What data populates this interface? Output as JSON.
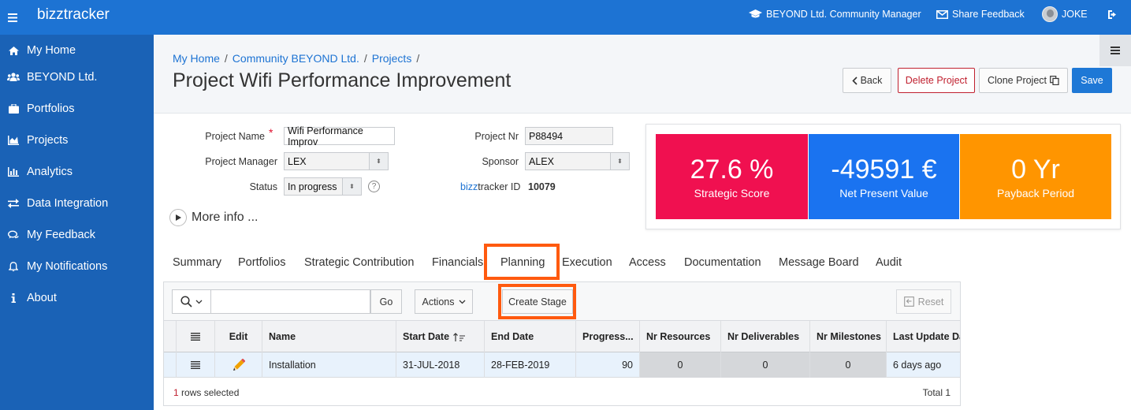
{
  "app": {
    "brand": "bizztracker",
    "role": "BEYOND Ltd. Community Manager",
    "feedback": "Share Feedback",
    "user": "JOKE"
  },
  "sidebar": {
    "items": [
      {
        "label": "My Home",
        "icon": "home-icon"
      },
      {
        "label": "BEYOND Ltd.",
        "icon": "users-icon"
      },
      {
        "label": "Portfolios",
        "icon": "briefcase-icon"
      },
      {
        "label": "Projects",
        "icon": "area-chart-icon"
      },
      {
        "label": "Analytics",
        "icon": "bar-chart-icon"
      },
      {
        "label": "Data Integration",
        "icon": "exchange-icon"
      },
      {
        "label": "My Feedback",
        "icon": "comments-icon"
      },
      {
        "label": "My Notifications",
        "icon": "bell-icon"
      },
      {
        "label": "About",
        "icon": "info-icon"
      }
    ]
  },
  "breadcrumb": {
    "items": [
      "My Home",
      "Community BEYOND Ltd.",
      "Projects"
    ],
    "sep": "/"
  },
  "page": {
    "title": "Project Wifi Performance Improvement",
    "buttons": {
      "back": "Back",
      "delete": "Delete Project",
      "clone": "Clone Project",
      "save": "Save"
    }
  },
  "form": {
    "project_name_label": "Project Name",
    "project_name_required": "*",
    "project_name_value": "Wifi Performance Improv",
    "project_manager_label": "Project Manager",
    "project_manager_value": "LEX",
    "status_label": "Status",
    "status_value": "In progress",
    "help": "?",
    "project_nr_label": "Project Nr",
    "project_nr_value": "P88494",
    "sponsor_label": "Sponsor",
    "sponsor_value": "ALEX",
    "id_label_brand": "bizz",
    "id_label_rest": "tracker ID",
    "id_value": "10079",
    "more_info": "More info ..."
  },
  "kpis": [
    {
      "value": "27.6 %",
      "label": "Strategic Score",
      "color": "#f01050"
    },
    {
      "value": "-49591 €",
      "label": "Net Present Value",
      "color": "#1a73f0"
    },
    {
      "value": "0 Yr",
      "label": "Payback Period",
      "color": "#ff9500"
    }
  ],
  "tabs": [
    "Summary",
    "Portfolios",
    "Strategic Contribution",
    "Financials",
    "Planning",
    "Execution",
    "Access",
    "Documentation",
    "Message Board",
    "Audit"
  ],
  "active_tab": "Planning",
  "highlight_color": "#ff5a0f",
  "toolbar": {
    "go": "Go",
    "actions": "Actions",
    "create_stage": "Create Stage",
    "reset": "Reset"
  },
  "grid": {
    "columns": [
      "Edit",
      "Name",
      "Start Date",
      "End Date",
      "Progress...",
      "Nr Resources",
      "Nr Deliverables",
      "Nr Milestones",
      "Last Update Da"
    ],
    "rows": [
      {
        "name": "Installation",
        "start": "31-JUL-2018",
        "end": "28-FEB-2019",
        "progress": "90",
        "resources": "0",
        "deliverables": "0",
        "milestones": "0",
        "last_update": "6 days ago"
      }
    ],
    "rows_selected_count": "1",
    "rows_selected_text": " rows selected",
    "total": "Total 1"
  }
}
